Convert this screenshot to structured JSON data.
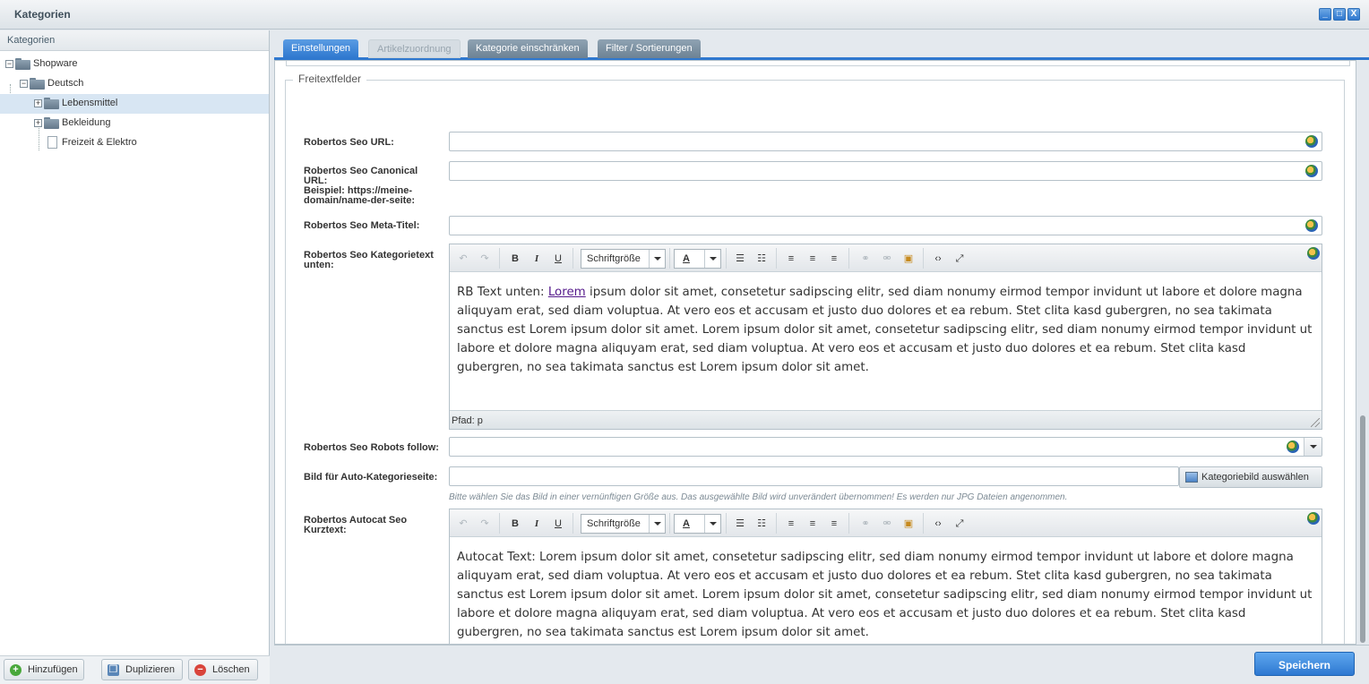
{
  "window": {
    "title": "Kategorien",
    "controls": [
      "_",
      "□",
      "X"
    ]
  },
  "left_panel": {
    "header": "Kategorien",
    "tree": [
      {
        "label": "Shopware",
        "toggle": "−"
      },
      {
        "label": "Deutsch",
        "toggle": "−"
      },
      {
        "label": "Lebensmittel",
        "toggle": "+"
      },
      {
        "label": "Bekleidung",
        "toggle": "+"
      },
      {
        "label": "Freizeit & Elektro"
      }
    ],
    "footer": {
      "add": "Hinzufügen",
      "duplicate": "Duplizieren",
      "delete": "Löschen"
    }
  },
  "tabs": [
    {
      "label": "Einstellungen",
      "state": "active"
    },
    {
      "label": "Artikelzuordnung",
      "state": "disabled"
    },
    {
      "label": "Kategorie einschränken",
      "state": "normal"
    },
    {
      "label": "Filter / Sortierungen",
      "state": "normal"
    }
  ],
  "fieldset": {
    "legend": "Freitextfelder",
    "seo_url": {
      "label": "Robertos Seo URL:",
      "value": ""
    },
    "canonical": {
      "label": "Robertos Seo Canonical URL:",
      "hint": "Beispiel: https://meine-domain/name-der-seite:",
      "value": ""
    },
    "meta_title": {
      "label": "Robertos Seo Meta-Titel:",
      "value": ""
    },
    "kategorietext": {
      "label": "Robertos Seo Kategorietext unten:",
      "prefix": "RB Text unten: ",
      "link": "Lorem",
      "text": " ipsum dolor sit amet, consetetur sadipscing elitr, sed diam nonumy eirmod tempor invidunt ut labore et dolore magna aliquyam erat, sed diam voluptua. At vero eos et accusam et justo duo dolores et ea rebum. Stet clita kasd gubergren, no sea takimata sanctus est Lorem ipsum dolor sit amet. Lorem ipsum dolor sit amet, consetetur sadipscing elitr, sed diam nonumy eirmod tempor invidunt ut labore et dolore magna aliquyam erat, sed diam voluptua. At vero eos et accusam et justo duo dolores et ea rebum. Stet clita kasd gubergren, no sea takimata sanctus est Lorem ipsum dolor sit amet.",
      "path": "Pfad: p"
    },
    "robots_follow": {
      "label": "Robertos Seo Robots follow:",
      "value": ""
    },
    "auto_image": {
      "label": "Bild für Auto-Kategorieseite:",
      "value": "",
      "button": "Kategoriebild auswählen",
      "help": "Bitte wählen Sie das Bild in einer vernünftigen Größe aus. Das ausgewählte Bild wird unverändert übernommen! Es werden nur JPG Dateien angenommen."
    },
    "autocat": {
      "label": "Robertos Autocat Seo Kurztext:",
      "text": "Autocat Text: Lorem ipsum dolor sit amet, consetetur sadipscing elitr, sed diam nonumy eirmod tempor invidunt ut labore et dolore magna aliquyam erat, sed diam voluptua. At vero eos et accusam et justo duo dolores et ea rebum. Stet clita kasd gubergren, no sea takimata sanctus est Lorem ipsum dolor sit amet. Lorem ipsum dolor sit amet, consetetur sadipscing elitr, sed diam nonumy eirmod tempor invidunt ut labore et dolore magna aliquyam erat, sed diam voluptua. At vero eos et accusam et justo duo dolores et ea rebum. Stet clita kasd gubergren, no sea takimata sanctus est Lorem ipsum dolor sit amet."
    }
  },
  "editor_toolbar": {
    "bold": "B",
    "italic": "I",
    "underline": "U",
    "font_size": "Schriftgröße",
    "font_color": "A",
    "icons": [
      "undo-icon",
      "redo-icon",
      "bullet-list-icon",
      "numbered-list-icon",
      "align-left-icon",
      "align-center-icon",
      "align-right-icon",
      "link-icon",
      "unlink-icon",
      "image-icon",
      "code-icon",
      "fullscreen-icon"
    ]
  },
  "save_button": "Speichern",
  "colors": {
    "accent": "#2f78cf",
    "selected_row": "#d8e6f3",
    "link": "#551a8b"
  }
}
